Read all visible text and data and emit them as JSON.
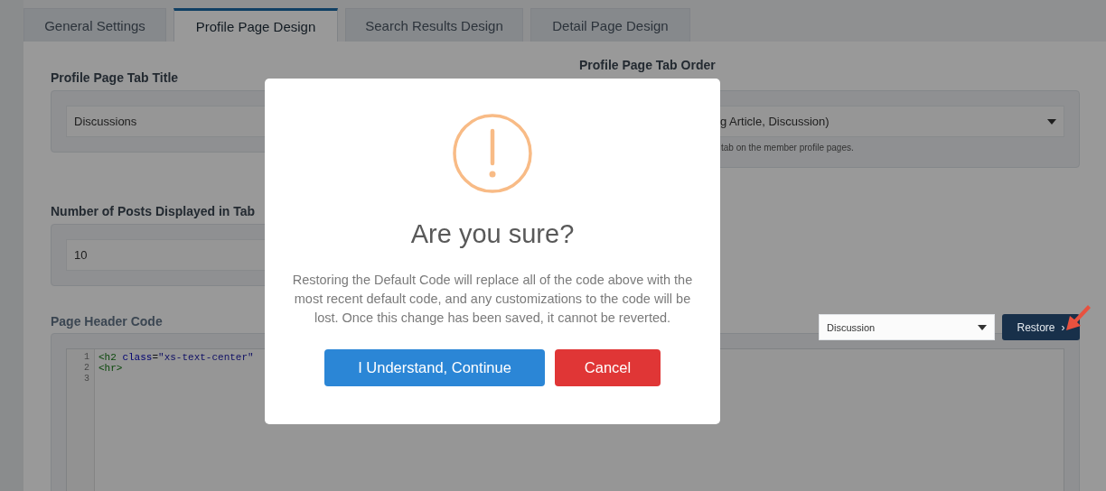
{
  "tabs": [
    {
      "label": "General Settings",
      "selected": false
    },
    {
      "label": "Profile Page Design",
      "selected": true
    },
    {
      "label": "Search Results Design",
      "selected": false
    },
    {
      "label": "Detail Page Design",
      "selected": false
    }
  ],
  "profile_tab_title": {
    "label": "Profile Page Tab Title",
    "value": "Discussions"
  },
  "profile_tab_order": {
    "label": "Profile Page Tab Order",
    "value": "g Article, Discussion)",
    "help": "tab on the member profile pages."
  },
  "posts_per_tab": {
    "label": "Number of Posts Displayed in Tab",
    "value": "10"
  },
  "header_code": {
    "label": "Page Header Code",
    "template": "Discussion",
    "restore_button": "Restore",
    "restore_chevron": "›",
    "line_numbers": [
      "1",
      "2",
      "3"
    ],
    "lines": [
      [
        {
          "kind": "tag",
          "text": "<h2"
        },
        {
          "kind": "attr",
          "text": " class"
        },
        {
          "kind": "punct",
          "text": "="
        },
        {
          "kind": "string",
          "text": "\"xs-text-center\""
        }
      ],
      [
        {
          "kind": "tag",
          "text": "<hr>"
        }
      ]
    ]
  },
  "dialog": {
    "title": "Are you sure?",
    "message": "Restoring the Default Code will replace all of the code above with the most recent default code, and any customizations to the code will be lost. Once this change has been saved, it cannot be reverted.",
    "buttons": [
      {
        "label": "I Understand, Continue",
        "kind": "confirm"
      },
      {
        "label": "Cancel",
        "kind": "cancel"
      }
    ]
  }
}
